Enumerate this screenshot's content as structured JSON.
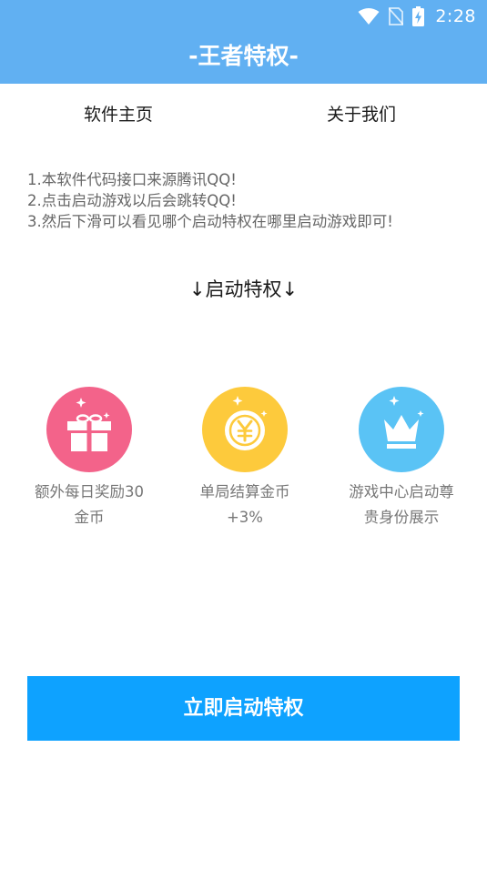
{
  "status_bar": {
    "time": "2:28",
    "icons": [
      "wifi-icon",
      "no-sim-icon",
      "battery-charging-icon"
    ]
  },
  "header": {
    "title": "-王者特权-"
  },
  "nav": {
    "home_label": "软件主页",
    "about_label": "关于我们"
  },
  "instructions": [
    "1.本软件代码接口来源腾讯QQ!",
    "2.点击启动游戏以后会跳转QQ!",
    "3.然后下滑可以看见哪个启动特权在哪里启动游戏即可!"
  ],
  "section": {
    "heading": "↓启动特权↓"
  },
  "features": [
    {
      "icon": "gift-icon",
      "color": "#f3638a",
      "label_line1": "额外每日奖励30",
      "label_line2": "金币"
    },
    {
      "icon": "coin-icon",
      "color": "#fdca3c",
      "label_line1": "单局结算金币",
      "label_line2": "+3%"
    },
    {
      "icon": "crown-icon",
      "color": "#5ac3f5",
      "label_line1": "游戏中心启动尊",
      "label_line2": "贵身份展示"
    }
  ],
  "action": {
    "start_label": "立即启动特权"
  },
  "colors": {
    "header_bg": "#61b0f2",
    "button_bg": "#0ea2ff"
  }
}
